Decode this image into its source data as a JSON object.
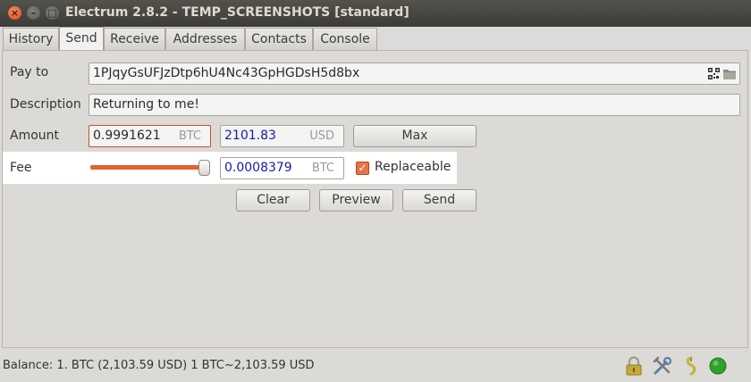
{
  "window": {
    "title": "Electrum 2.8.2  -  TEMP_SCREENSHOTS  [standard]"
  },
  "tabs": [
    {
      "label": "History"
    },
    {
      "label": "Send"
    },
    {
      "label": "Receive"
    },
    {
      "label": "Addresses"
    },
    {
      "label": "Contacts"
    },
    {
      "label": "Console"
    }
  ],
  "active_tab": "Send",
  "send": {
    "pay_to": {
      "label": "Pay to",
      "value": "1PJqyGsUFJzDtp6hU4Nc43GpHGDsH5d8bx"
    },
    "description": {
      "label": "Description",
      "value": "Returning to me!"
    },
    "amount": {
      "label": "Amount",
      "btc_value": "0.9991621",
      "btc_unit": "BTC",
      "fiat_value": "2101.83",
      "fiat_unit": "USD",
      "max_label": "Max"
    },
    "fee": {
      "label": "Fee",
      "value": "0.0008379",
      "unit": "BTC",
      "slider_level": 1.0,
      "replaceable_label": "Replaceable",
      "replaceable_checked": true
    },
    "buttons": {
      "clear": "Clear",
      "preview": "Preview",
      "send": "Send"
    }
  },
  "status_bar": {
    "text": "Balance: 1. BTC (2,103.59 USD)  1 BTC~2,103.59 USD"
  },
  "icons": {
    "close": "close-icon",
    "minimize": "minimize-icon",
    "maximize": "maximize-icon",
    "qr": "qr-code-icon",
    "folder": "folder-icon",
    "lock": "lock-icon",
    "preferences": "tools-icon",
    "seed": "seed-icon",
    "network": "network-status-icon"
  },
  "colors": {
    "accent": "#e0622d",
    "fiat_text": "#1a1aa6",
    "network_ok": "#2ea12a"
  }
}
